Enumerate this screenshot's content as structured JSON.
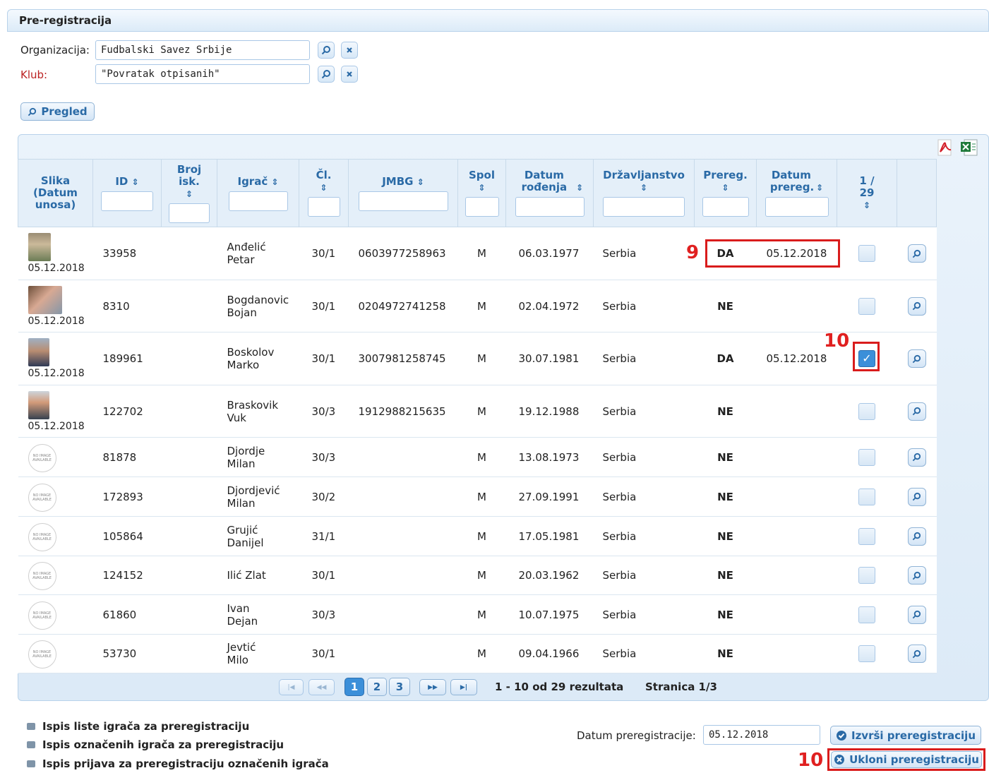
{
  "panel": {
    "title": "Pre-registracija"
  },
  "filters": {
    "organizacija_label": "Organizacija:",
    "organizacija_value": "Fudbalski Savez Srbije",
    "klub_label": "Klub:",
    "klub_value": "\"Povratak otpisanih\"",
    "pregled_label": "Pregled"
  },
  "table": {
    "columns": [
      "Slika (Datum unosa)",
      "ID",
      "Broj isk.",
      "Igrač",
      "Čl.",
      "JMBG",
      "Spol",
      "Datum rođenja",
      "Državljanstvo",
      "Prereg.",
      "Datum prereg.",
      "1 / 29",
      ""
    ],
    "rows": [
      {
        "photo_date": "05.12.2018",
        "id": "33958",
        "broj": "",
        "name1": "Anđelić",
        "name2": "Petar",
        "cl": "30/1",
        "jmbg": "0603977258963",
        "spol": "M",
        "dob": "06.03.1977",
        "drz": "Serbia",
        "prereg": "DA",
        "prereg_date": "05.12.2018",
        "checked": false
      },
      {
        "photo_date": "05.12.2018",
        "id": "8310",
        "broj": "",
        "name1": "Bogdanovic",
        "name2": "Bojan",
        "cl": "30/1",
        "jmbg": "0204972741258",
        "spol": "M",
        "dob": "02.04.1972",
        "drz": "Serbia",
        "prereg": "NE",
        "prereg_date": "",
        "checked": false
      },
      {
        "photo_date": "05.12.2018",
        "id": "189961",
        "broj": "",
        "name1": "Boskolov",
        "name2": "Marko",
        "cl": "30/1",
        "jmbg": "3007981258745",
        "spol": "M",
        "dob": "30.07.1981",
        "drz": "Serbia",
        "prereg": "DA",
        "prereg_date": "05.12.2018",
        "checked": true
      },
      {
        "photo_date": "05.12.2018",
        "id": "122702",
        "broj": "",
        "name1": "Braskovik",
        "name2": "Vuk",
        "cl": "30/3",
        "jmbg": "1912988215635",
        "spol": "M",
        "dob": "19.12.1988",
        "drz": "Serbia",
        "prereg": "NE",
        "prereg_date": "",
        "checked": false
      },
      {
        "photo_date": "",
        "id": "81878",
        "broj": "",
        "name1": "Djordje",
        "name2": "Milan",
        "cl": "30/3",
        "jmbg": "",
        "spol": "M",
        "dob": "13.08.1973",
        "drz": "Serbia",
        "prereg": "NE",
        "prereg_date": "",
        "checked": false
      },
      {
        "photo_date": "",
        "id": "172893",
        "broj": "",
        "name1": "Djordjević",
        "name2": "Milan",
        "cl": "30/2",
        "jmbg": "",
        "spol": "M",
        "dob": "27.09.1991",
        "drz": "Serbia",
        "prereg": "NE",
        "prereg_date": "",
        "checked": false
      },
      {
        "photo_date": "",
        "id": "105864",
        "broj": "",
        "name1": "Grujić",
        "name2": "Danijel",
        "cl": "31/1",
        "jmbg": "",
        "spol": "M",
        "dob": "17.05.1981",
        "drz": "Serbia",
        "prereg": "NE",
        "prereg_date": "",
        "checked": false
      },
      {
        "photo_date": "",
        "id": "124152",
        "broj": "",
        "name1": "Ilić Zlat",
        "name2": "",
        "cl": "30/1",
        "jmbg": "",
        "spol": "M",
        "dob": "20.03.1962",
        "drz": "Serbia",
        "prereg": "NE",
        "prereg_date": "",
        "checked": false
      },
      {
        "photo_date": "",
        "id": "61860",
        "broj": "",
        "name1": "Ivan",
        "name2": "Dejan",
        "cl": "30/3",
        "jmbg": "",
        "spol": "M",
        "dob": "10.07.1975",
        "drz": "Serbia",
        "prereg": "NE",
        "prereg_date": "",
        "checked": false
      },
      {
        "photo_date": "",
        "id": "53730",
        "broj": "",
        "name1": "Jevtić",
        "name2": "Milo",
        "cl": "30/1",
        "jmbg": "",
        "spol": "M",
        "dob": "09.04.1966",
        "drz": "Serbia",
        "prereg": "NE",
        "prereg_date": "",
        "checked": false
      }
    ],
    "no_image_text": "NO IMAGE AVAILABLE"
  },
  "pager": {
    "pages": [
      "1",
      "2",
      "3"
    ],
    "current": "1",
    "results": "1 - 10 od 29 rezultata",
    "page_info": "Stranica 1/3"
  },
  "bottom": {
    "links": [
      "Ispis liste igrača za preregistraciju",
      "Ispis označenih igrača za preregistraciju",
      "Ispis prijava za preregistraciju označenih igrača"
    ],
    "datum_label": "Datum preregistracije:",
    "datum_value": "05.12.2018",
    "izvrsi_label": "Izvrši preregistraciju",
    "ukloni_label": "Ukloni preregistraciju"
  },
  "annotations": {
    "a9": "9",
    "a10_top": "10",
    "a10_bottom": "10"
  },
  "colors": {
    "accent": "#2a6aa6",
    "da": "#3a9a1e",
    "ne": "#c40a0a",
    "highlight": "#d91c1c"
  }
}
